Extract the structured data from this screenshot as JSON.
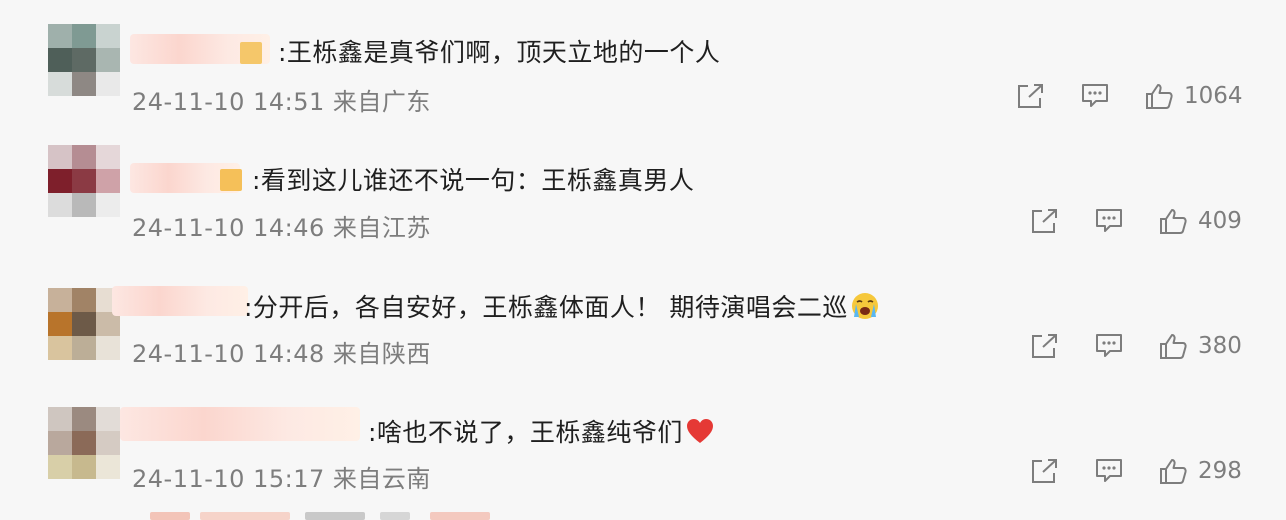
{
  "comments": [
    {
      "text": ":王栎鑫是真爷们啊，顶天立地的一个人",
      "time": "24-11-10 14:51",
      "location": "来自广东",
      "likes": "1064"
    },
    {
      "text": ":看到这儿谁还不说一句：王栎鑫真男人",
      "time": "24-11-10 14:46",
      "location": "来自江苏",
      "likes": "409"
    },
    {
      "text": ":分开后，各自安好，王栎鑫体面人！ 期待演唱会二巡",
      "time": "24-11-10 14:48",
      "location": "来自陕西",
      "likes": "380"
    },
    {
      "text": ":啥也不说了，王栎鑫纯爷们",
      "time": "24-11-10 15:17",
      "location": "来自云南",
      "likes": "298"
    }
  ],
  "icons": {
    "share": "share-icon",
    "comment": "comment-icon",
    "like": "thumbs-up-icon",
    "crying_emoji": "loudly-crying-face-emoji",
    "heart_emoji": "red-heart-emoji"
  },
  "colors": {
    "text": "#1f1f1f",
    "meta": "#7d7d7d",
    "heart": "#e53935",
    "background": "#f7f7f7"
  }
}
